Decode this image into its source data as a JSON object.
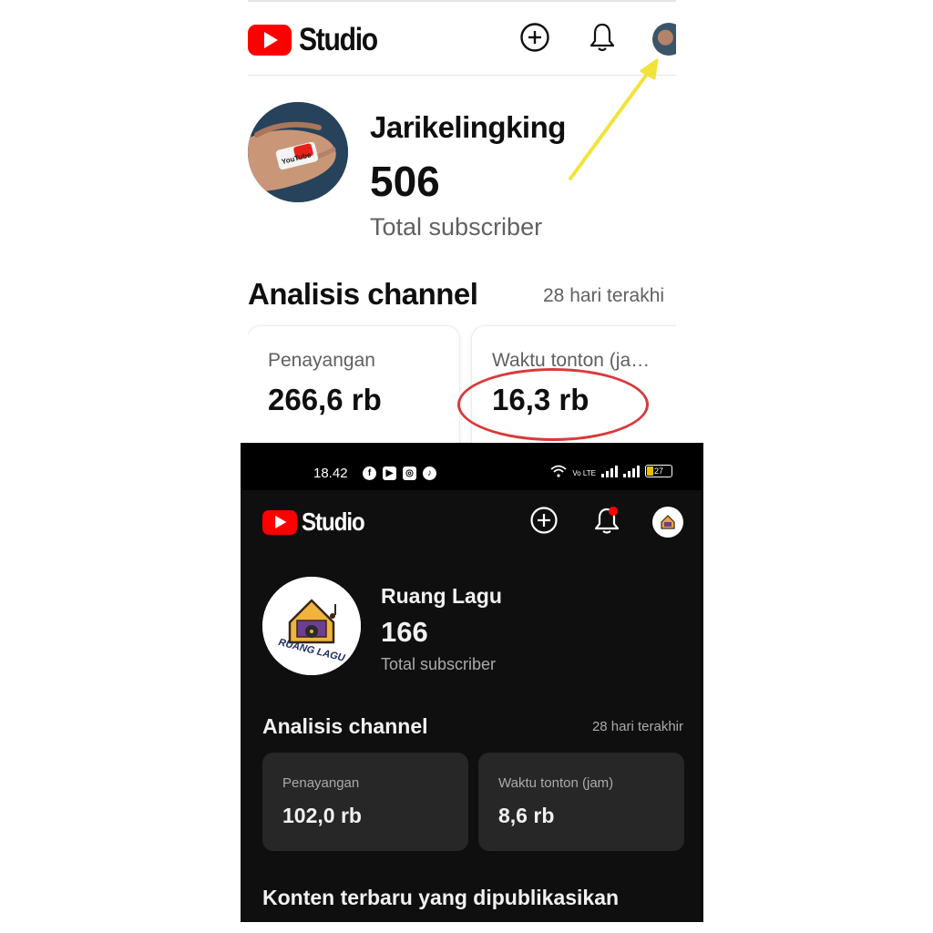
{
  "light": {
    "app_name": "Studio",
    "channel_name": "Jarikelingking",
    "subscriber_count": "506",
    "subscriber_label": "Total subscriber",
    "avatar_logo_text": "YouTube",
    "section_title": "Analisis channel",
    "period": "28 hari terakhi",
    "cards": [
      {
        "label": "Penayangan",
        "value": "266,6 rb"
      },
      {
        "label": "Waktu tonton (ja…",
        "value": "16,3 rb"
      }
    ]
  },
  "dark": {
    "status": {
      "time": "18.42",
      "volte": "Vo LTE",
      "battery": "27"
    },
    "app_name": "Studio",
    "channel_name": "Ruang Lagu",
    "subscriber_count": "166",
    "subscriber_label": "Total subscriber",
    "avatar_logo_text": "RUANG LAGU",
    "section_title": "Analisis channel",
    "period": "28 hari terakhir",
    "cards": [
      {
        "label": "Penayangan",
        "value": "102,0 rb"
      },
      {
        "label": "Waktu tonton (jam)",
        "value": "8,6 rb"
      }
    ],
    "recent_title": "Konten terbaru yang dipublikasikan"
  },
  "annotations": {
    "arrow_color": "#f2e33a",
    "circle_color": "#d93a3a"
  },
  "colors": {
    "youtube_red": "#ff0000",
    "dark_bg": "#0f0f0f",
    "dark_card": "#272727",
    "notification_dot": "#ff0000"
  }
}
